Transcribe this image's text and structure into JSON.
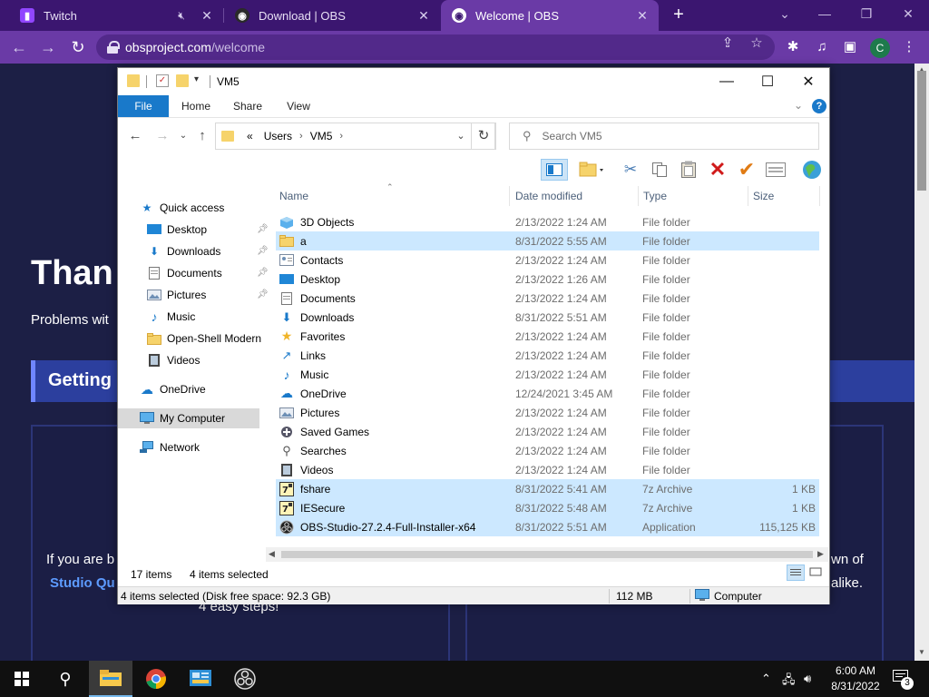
{
  "browser": {
    "tabs": [
      {
        "title": "Twitch",
        "favicon": "twitch-icon",
        "muted": true
      },
      {
        "title": "Download | OBS",
        "favicon": "obs-icon"
      },
      {
        "title": "Welcome | OBS",
        "favicon": "obs-icon",
        "active": true
      }
    ],
    "url_host": "obsproject.com",
    "url_path": "/welcome",
    "avatar_letter": "C",
    "accent": "#6a3aa6"
  },
  "page": {
    "heading": "Than",
    "subtext": "Problems wit",
    "getting": "Getting",
    "card_left_line1": "If you are b",
    "card_left_link": "Studio Qu",
    "card_left_line3": "4 easy steps!",
    "card_right_line1": "wn of",
    "card_right_line2": "alike."
  },
  "explorer": {
    "title": "VM5",
    "ribbon_tabs": [
      "File",
      "Home",
      "Share",
      "View"
    ],
    "breadcrumb": [
      "«",
      "Users",
      "VM5"
    ],
    "search_placeholder": "Search VM5",
    "nav": {
      "quick_access": "Quick access",
      "pinned": [
        {
          "label": "Desktop",
          "icon": "desktop-icon"
        },
        {
          "label": "Downloads",
          "icon": "download-icon"
        },
        {
          "label": "Documents",
          "icon": "documents-icon"
        },
        {
          "label": "Pictures",
          "icon": "pictures-icon"
        }
      ],
      "unpinned": [
        {
          "label": "Music",
          "icon": "music-icon"
        },
        {
          "label": "Open-Shell Modern",
          "icon": "folder-icon"
        },
        {
          "label": "Videos",
          "icon": "videos-icon"
        }
      ],
      "onedrive": "OneDrive",
      "computer": "My Computer",
      "network": "Network"
    },
    "columns": [
      "Name",
      "Date modified",
      "Type",
      "Size"
    ],
    "files": [
      {
        "name": "3D Objects",
        "date": "2/13/2022 1:24 AM",
        "type": "File folder",
        "size": "",
        "icon": "3d-objects-icon",
        "selected": false
      },
      {
        "name": "a",
        "date": "8/31/2022 5:55 AM",
        "type": "File folder",
        "size": "",
        "icon": "folder-icon",
        "selected": true
      },
      {
        "name": "Contacts",
        "date": "2/13/2022 1:24 AM",
        "type": "File folder",
        "size": "",
        "icon": "contacts-icon",
        "selected": false
      },
      {
        "name": "Desktop",
        "date": "2/13/2022 1:26 AM",
        "type": "File folder",
        "size": "",
        "icon": "desktop-icon",
        "selected": false
      },
      {
        "name": "Documents",
        "date": "2/13/2022 1:24 AM",
        "type": "File folder",
        "size": "",
        "icon": "documents-icon",
        "selected": false
      },
      {
        "name": "Downloads",
        "date": "8/31/2022 5:51 AM",
        "type": "File folder",
        "size": "",
        "icon": "download-icon",
        "selected": false
      },
      {
        "name": "Favorites",
        "date": "2/13/2022 1:24 AM",
        "type": "File folder",
        "size": "",
        "icon": "star-icon",
        "selected": false
      },
      {
        "name": "Links",
        "date": "2/13/2022 1:24 AM",
        "type": "File folder",
        "size": "",
        "icon": "links-icon",
        "selected": false
      },
      {
        "name": "Music",
        "date": "2/13/2022 1:24 AM",
        "type": "File folder",
        "size": "",
        "icon": "music-icon",
        "selected": false
      },
      {
        "name": "OneDrive",
        "date": "12/24/2021 3:45 AM",
        "type": "File folder",
        "size": "",
        "icon": "cloud-icon",
        "selected": false
      },
      {
        "name": "Pictures",
        "date": "2/13/2022 1:24 AM",
        "type": "File folder",
        "size": "",
        "icon": "pictures-icon",
        "selected": false
      },
      {
        "name": "Saved Games",
        "date": "2/13/2022 1:24 AM",
        "type": "File folder",
        "size": "",
        "icon": "saved-games-icon",
        "selected": false
      },
      {
        "name": "Searches",
        "date": "2/13/2022 1:24 AM",
        "type": "File folder",
        "size": "",
        "icon": "search-icon",
        "selected": false
      },
      {
        "name": "Videos",
        "date": "2/13/2022 1:24 AM",
        "type": "File folder",
        "size": "",
        "icon": "videos-icon",
        "selected": false
      },
      {
        "name": "fshare",
        "date": "8/31/2022 5:41 AM",
        "type": "7z Archive",
        "size": "1 KB",
        "icon": "archive-icon",
        "selected": true
      },
      {
        "name": "IESecure",
        "date": "8/31/2022 5:48 AM",
        "type": "7z Archive",
        "size": "1 KB",
        "icon": "archive-icon",
        "selected": true
      },
      {
        "name": "OBS-Studio-27.2.4-Full-Installer-x64",
        "date": "8/31/2022 5:51 AM",
        "type": "Application",
        "size": "115,125 KB",
        "icon": "obs-icon",
        "selected": true
      }
    ],
    "status_items": "17 items",
    "status_selected": "4 items selected",
    "detail_left": "4 items selected (Disk free space: 92.3 GB)",
    "detail_size": "112 MB",
    "detail_location": "Computer"
  },
  "taskbar": {
    "time": "6:00 AM",
    "date": "8/31/2022",
    "notifications": "3"
  }
}
